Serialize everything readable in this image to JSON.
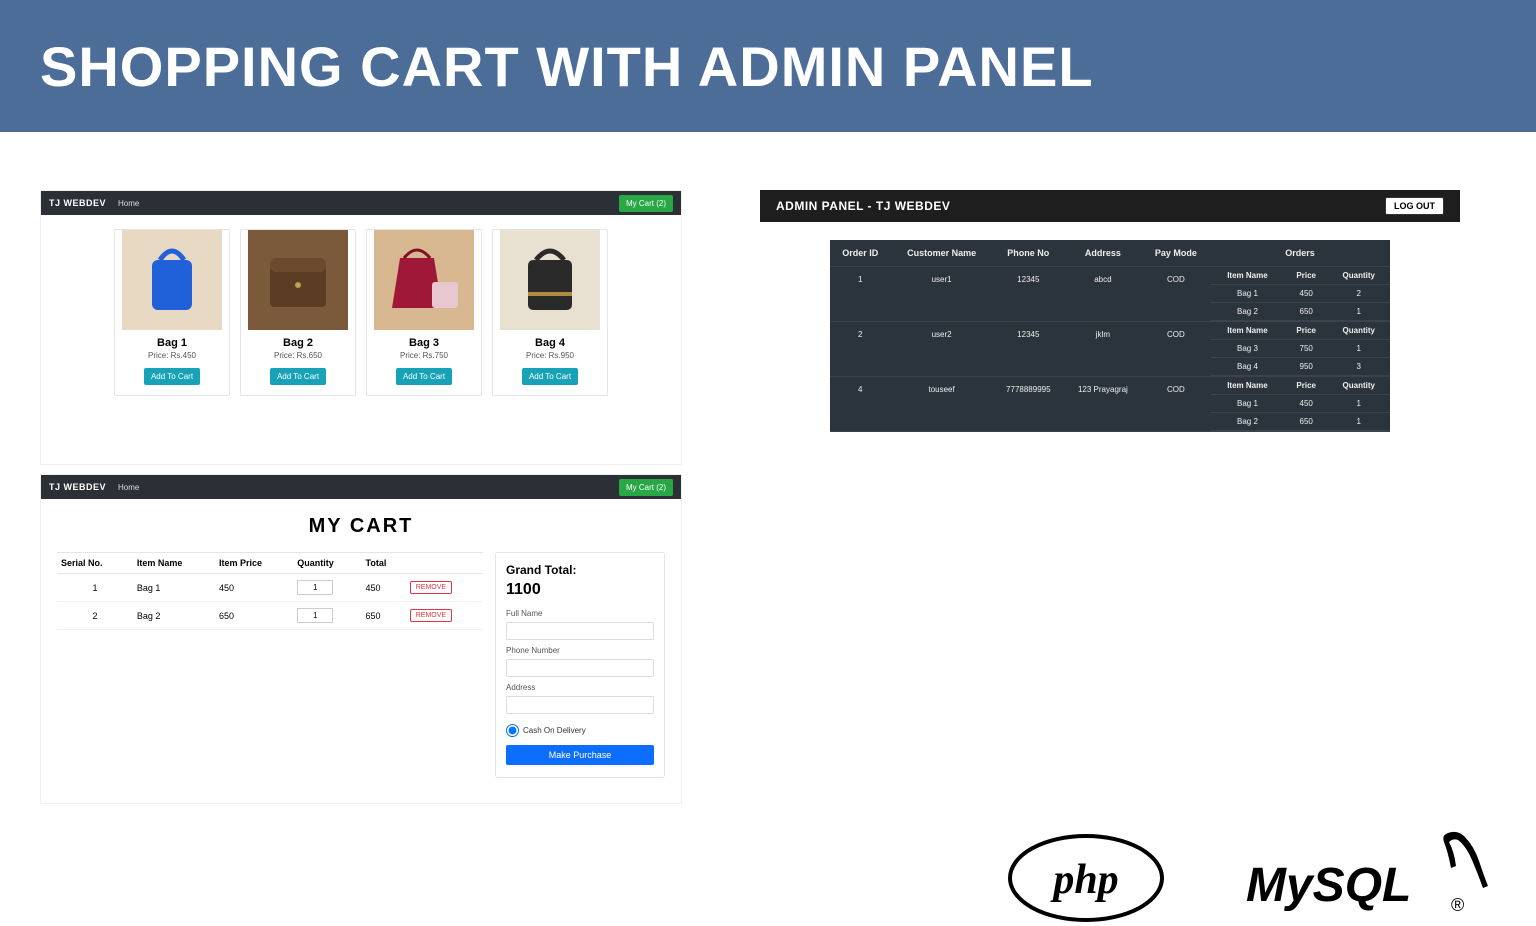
{
  "hero": {
    "title": "SHOPPING CART WITH ADMIN PANEL"
  },
  "shop": {
    "brand": "TJ WEBDEV",
    "home": "Home",
    "cart_button": "My Cart (2)",
    "products": [
      {
        "name": "Bag 1",
        "price": "Price: Rs.450",
        "btn": "Add To Cart"
      },
      {
        "name": "Bag 2",
        "price": "Price: Rs.650",
        "btn": "Add To Cart"
      },
      {
        "name": "Bag 3",
        "price": "Price: Rs.750",
        "btn": "Add To Cart"
      },
      {
        "name": "Bag 4",
        "price": "Price: Rs.950",
        "btn": "Add To Cart"
      }
    ]
  },
  "cart": {
    "brand": "TJ WEBDEV",
    "home": "Home",
    "cart_button": "My Cart (2)",
    "title": "MY CART",
    "columns": {
      "sn": "Serial No.",
      "name": "Item Name",
      "price": "Item Price",
      "qty": "Quantity",
      "total": "Total",
      "action": ""
    },
    "rows": [
      {
        "sn": "1",
        "name": "Bag 1",
        "price": "450",
        "qty": "1",
        "total": "450",
        "remove": "REMOVE"
      },
      {
        "sn": "2",
        "name": "Bag 2",
        "price": "650",
        "qty": "1",
        "total": "650",
        "remove": "REMOVE"
      }
    ],
    "checkout": {
      "grand_label": "Grand Total:",
      "grand_value": "1100",
      "full_name_label": "Full Name",
      "phone_label": "Phone Number",
      "address_label": "Address",
      "cod_label": "Cash On Delivery",
      "purchase": "Make Purchase"
    }
  },
  "admin": {
    "title": "ADMIN PANEL - TJ WEBDEV",
    "logout": "LOG OUT",
    "columns": {
      "oid": "Order ID",
      "cust": "Customer Name",
      "phone": "Phone No",
      "addr": "Address",
      "pay": "Pay Mode",
      "orders": "Orders"
    },
    "sub_columns": {
      "item": "Item Name",
      "price": "Price",
      "qty": "Quantity"
    },
    "rows": [
      {
        "oid": "1",
        "cust": "user1",
        "phone": "12345",
        "addr": "abcd",
        "pay": "COD",
        "items": [
          {
            "item": "Bag 1",
            "price": "450",
            "qty": "2"
          },
          {
            "item": "Bag 2",
            "price": "650",
            "qty": "1"
          }
        ]
      },
      {
        "oid": "2",
        "cust": "user2",
        "phone": "12345",
        "addr": "jklm",
        "pay": "COD",
        "items": [
          {
            "item": "Bag 3",
            "price": "750",
            "qty": "1"
          },
          {
            "item": "Bag 4",
            "price": "950",
            "qty": "3"
          }
        ]
      },
      {
        "oid": "4",
        "cust": "touseef",
        "phone": "7778889995",
        "addr": "123 Prayagraj",
        "pay": "COD",
        "items": [
          {
            "item": "Bag 1",
            "price": "450",
            "qty": "1"
          },
          {
            "item": "Bag 2",
            "price": "650",
            "qty": "1"
          }
        ]
      }
    ]
  },
  "logos": {
    "php": "php",
    "mysql": "MySQL"
  }
}
